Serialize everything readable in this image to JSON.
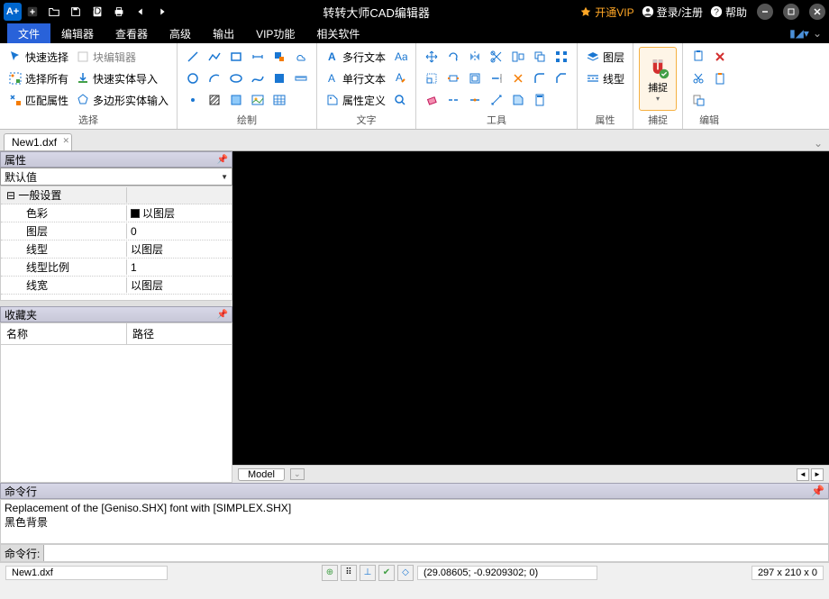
{
  "titlebar": {
    "logo": "A+",
    "title": "转转大师CAD编辑器",
    "vip": "开通VIP",
    "login": "登录/注册",
    "help": "帮助"
  },
  "menu": {
    "tabs": [
      "文件",
      "编辑器",
      "查看器",
      "高级",
      "输出",
      "VIP功能",
      "相关软件"
    ],
    "active_index": 0
  },
  "ribbon": {
    "select": {
      "quick_select": "快速选择",
      "select_all": "选择所有",
      "match_prop": "匹配属性",
      "block_editor": "块编辑器",
      "quick_import": "快速实体导入",
      "poly_input": "多边形实体输入",
      "label": "选择"
    },
    "draw": {
      "label": "绘制"
    },
    "text": {
      "mtext": "多行文本",
      "stext": "单行文本",
      "attdef": "属性定义",
      "label": "文字"
    },
    "tools": {
      "label": "工具"
    },
    "properties": {
      "layer": "图层",
      "linetype": "线型",
      "label": "属性"
    },
    "snap": {
      "label": "捕捉"
    },
    "edit": {
      "label": "编辑"
    }
  },
  "doc": {
    "tab": "New1.dxf"
  },
  "props_panel": {
    "title": "属性",
    "combo": "默认值",
    "section": "一般设置",
    "rows": {
      "color_k": "色彩",
      "color_v": "以图层",
      "layer_k": "图层",
      "layer_v": "0",
      "ltype_k": "线型",
      "ltype_v": "以图层",
      "lscale_k": "线型比例",
      "lscale_v": "1",
      "lweight_k": "线宽",
      "lweight_v": "以图层"
    }
  },
  "fav_panel": {
    "title": "收藏夹",
    "col_name": "名称",
    "col_path": "路径"
  },
  "model_tab": "Model",
  "cmd": {
    "title": "命令行",
    "log1": "Replacement of the [Geniso.SHX] font with [SIMPLEX.SHX]",
    "log2": "黑色背景",
    "prompt": "命令行:"
  },
  "status": {
    "file": "New1.dxf",
    "coords": "(29.08605; -0.9209302; 0)",
    "dims": "297 x 210 x 0"
  }
}
